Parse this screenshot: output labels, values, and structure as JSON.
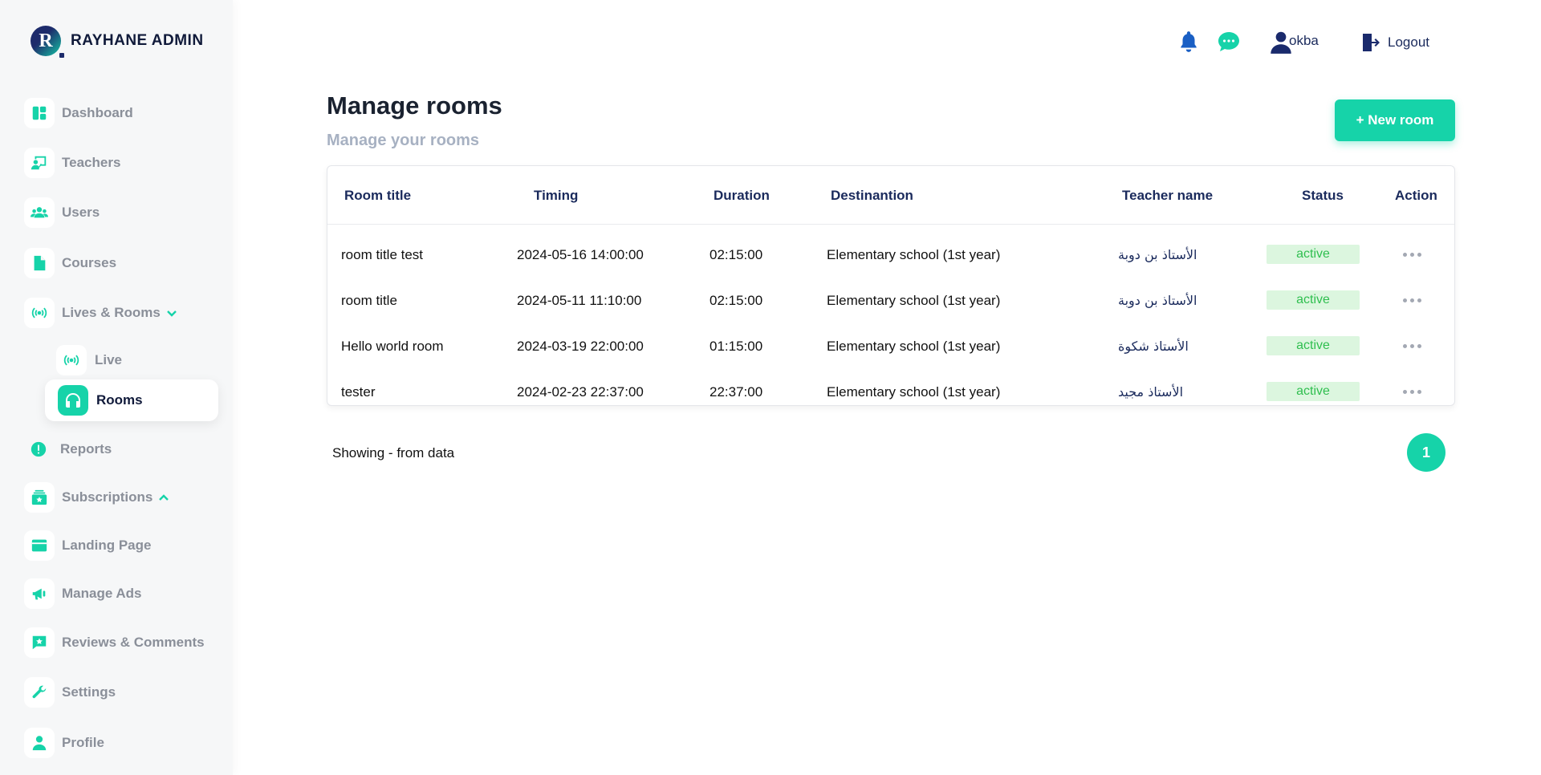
{
  "brand": {
    "logo_letter": "R",
    "name": "RAYHANE ADMIN"
  },
  "colors": {
    "accent": "#16d3a9",
    "navy": "#1a2a5c",
    "status_bg": "#dcf6df",
    "status_text": "#2fbf4f"
  },
  "sidebar": {
    "items": [
      {
        "label": "Dashboard",
        "icon": "dashboard-icon"
      },
      {
        "label": "Teachers",
        "icon": "teacher-board-icon"
      },
      {
        "label": "Users",
        "icon": "users-icon"
      },
      {
        "label": "Courses",
        "icon": "file-icon"
      },
      {
        "label": "Lives & Rooms",
        "icon": "broadcast-icon",
        "expanded": true
      },
      {
        "label": "Live",
        "icon": "broadcast-icon"
      },
      {
        "label": "Rooms",
        "icon": "headphones-icon",
        "active": true
      },
      {
        "label": "Reports",
        "icon": "alert-icon"
      },
      {
        "label": "Subscriptions",
        "icon": "subscription-icon",
        "expanded": false
      },
      {
        "label": "Landing Page",
        "icon": "card-icon"
      },
      {
        "label": "Manage Ads",
        "icon": "megaphone-icon"
      },
      {
        "label": "Reviews & Comments",
        "icon": "review-icon"
      },
      {
        "label": "Settings",
        "icon": "wrench-icon"
      },
      {
        "label": "Profile",
        "icon": "user-icon"
      }
    ]
  },
  "header": {
    "user_name": "okba",
    "logout_label": "Logout"
  },
  "main": {
    "title": "Manage rooms",
    "subtitle": "Manage your rooms",
    "new_room_label": "+ New room",
    "table": {
      "columns": [
        "Room title",
        "Timing",
        "Duration",
        "Destinantion",
        "Teacher name",
        "Status",
        "Action"
      ],
      "rows": [
        {
          "title": "room title test",
          "timing": "2024-05-16 14:00:00",
          "duration": "02:15:00",
          "destination": "Elementary school (1st year)",
          "teacher": "الأستاذ بن دوبة",
          "status": "active"
        },
        {
          "title": "room title",
          "timing": "2024-05-11 11:10:00",
          "duration": "02:15:00",
          "destination": "Elementary school (1st year)",
          "teacher": "الأستاذ بن دوبة",
          "status": "active"
        },
        {
          "title": "Hello world room",
          "timing": "2024-03-19 22:00:00",
          "duration": "01:15:00",
          "destination": "Elementary school (1st year)",
          "teacher": "الأستاذ شكوة",
          "status": "active"
        },
        {
          "title": "tester",
          "timing": "2024-02-23 22:37:00",
          "duration": "22:37:00",
          "destination": "Elementary school (1st year)",
          "teacher": "الأستاذ مجيد",
          "status": "active"
        }
      ]
    },
    "showing_text": "Showing - from data",
    "current_page": "1"
  }
}
